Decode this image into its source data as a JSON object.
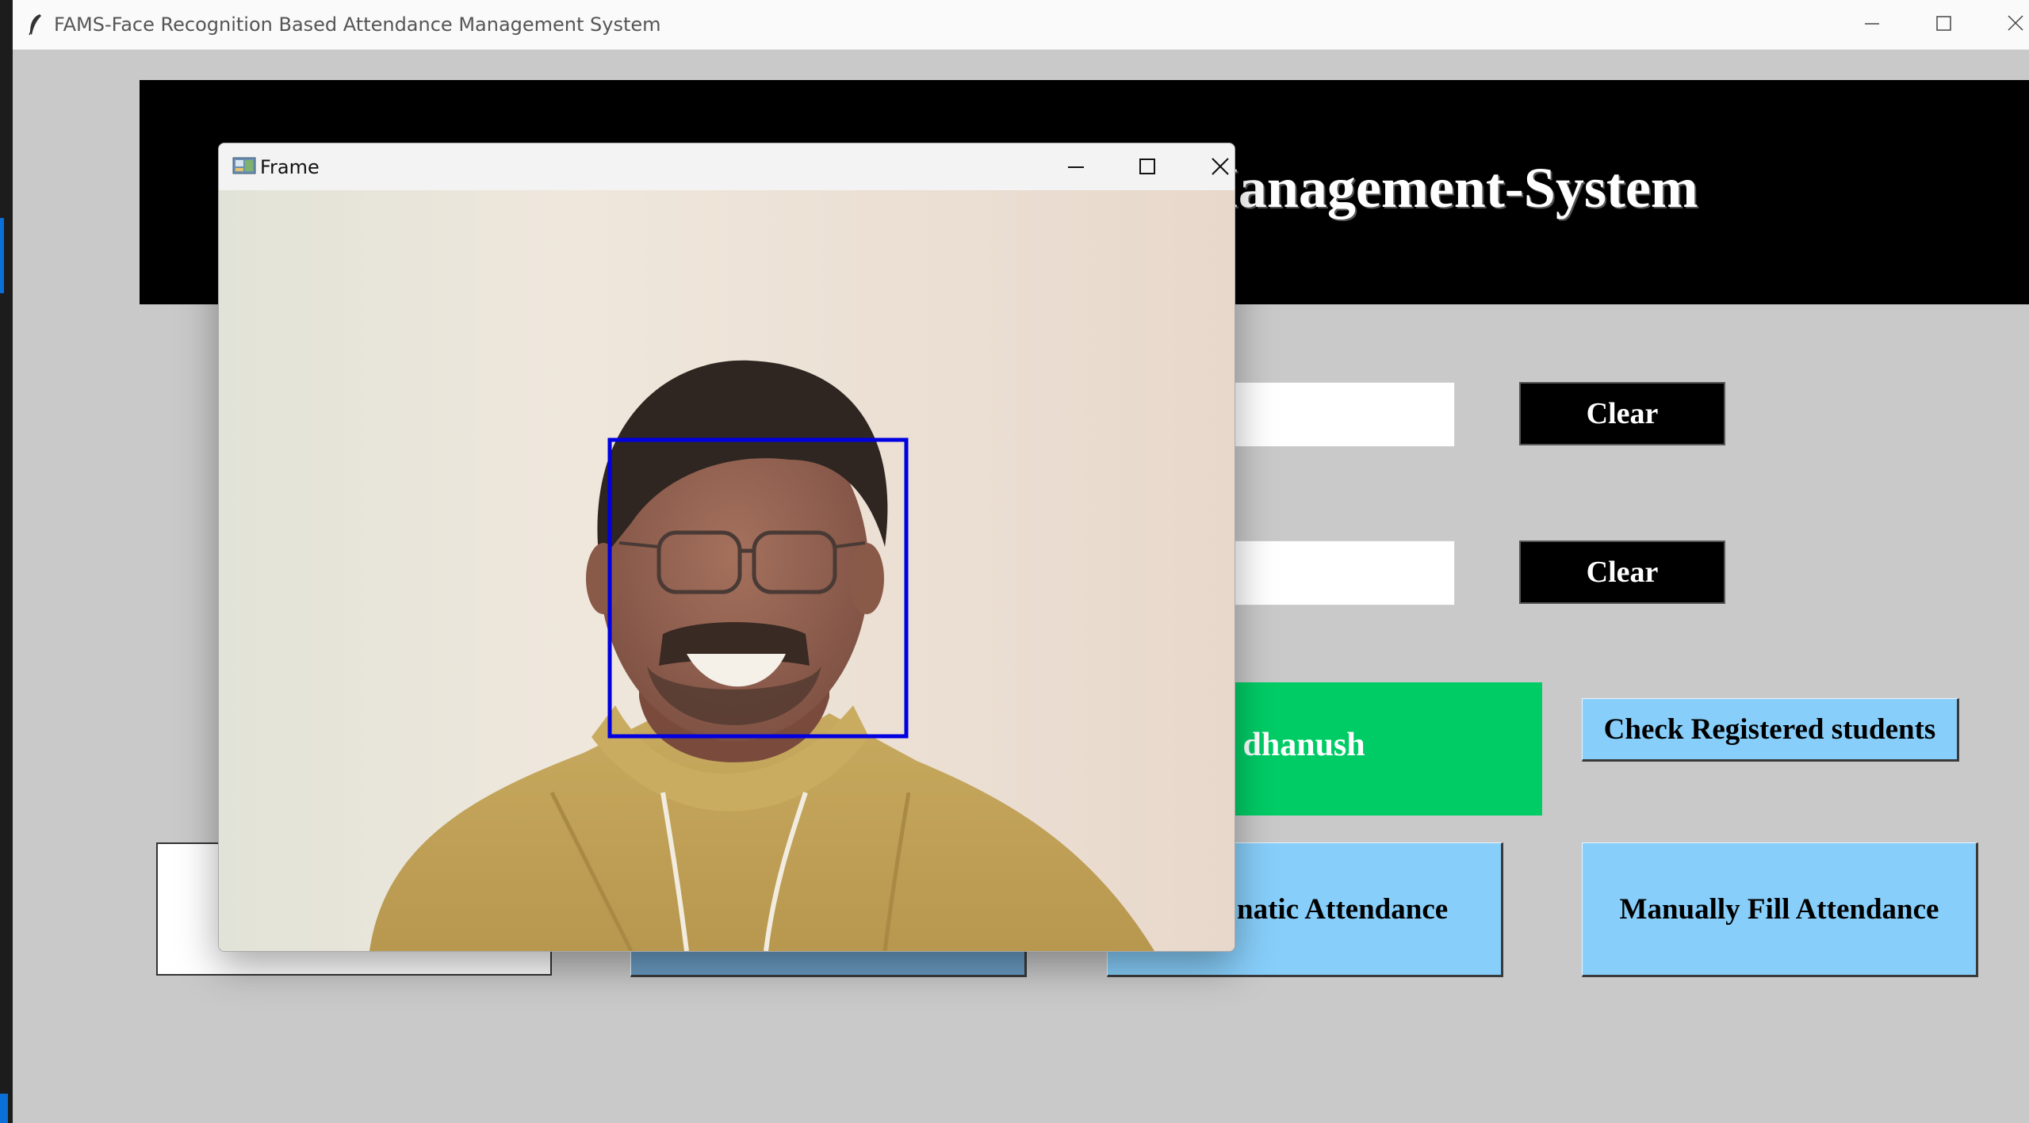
{
  "main_window": {
    "title": "FAMS-Face Recognition Based Attendance Management System",
    "header_title": "ce-Management-System",
    "clear_button_1": "Clear",
    "clear_button_2": "Clear",
    "notification_text": "x dhanush",
    "check_registered_button": "Check Registered students",
    "automatic_attendance_button": "natic Attendance",
    "manual_attendance_button": "Manually Fill Attendance",
    "colors": {
      "background": "#c9c9c9",
      "banner": "#000000",
      "notification": "#00cc66",
      "button_blue": "#87cefa"
    }
  },
  "frame_window": {
    "title": "Frame",
    "face_box_color": "#0000e0"
  },
  "icons": [
    "feather-icon",
    "minimize-icon",
    "maximize-icon",
    "close-icon",
    "frame-app-icon"
  ]
}
